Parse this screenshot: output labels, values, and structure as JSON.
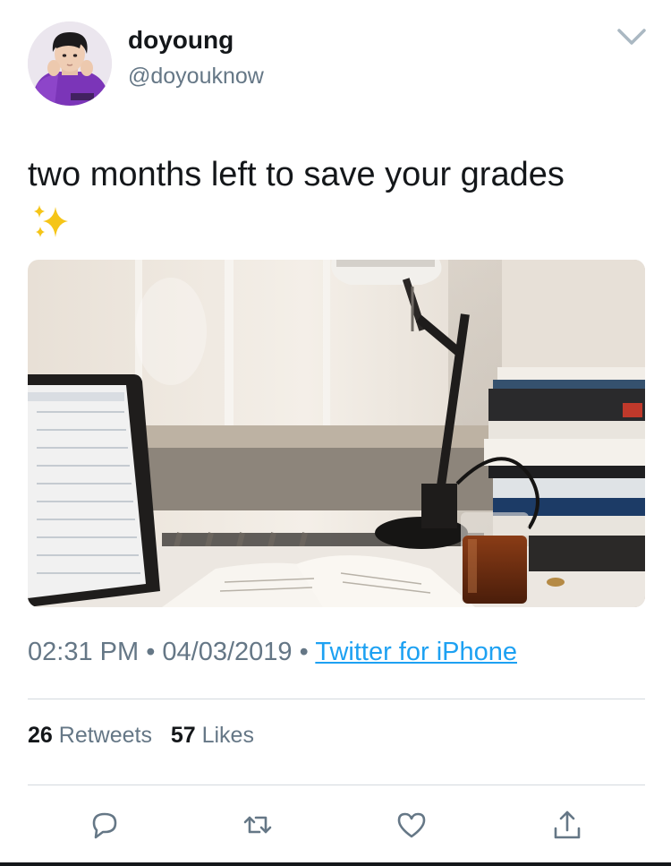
{
  "author": {
    "display_name": "doyoung",
    "handle": "@doyouknow"
  },
  "tweet": {
    "text": "two months left to save your grades",
    "emoji": "sparkles"
  },
  "meta": {
    "time": "02:31 PM",
    "separator": "•",
    "date": "04/03/2019",
    "source": "Twitter for iPhone"
  },
  "stats": {
    "retweets_count": "26",
    "retweets_label": "Retweets",
    "likes_count": "57",
    "likes_label": "Likes"
  },
  "icons": {
    "menu": "chevron-down-icon",
    "reply": "reply-icon",
    "retweet": "retweet-icon",
    "like": "heart-icon",
    "share": "share-icon"
  },
  "colors": {
    "text_primary": "#14171a",
    "text_secondary": "#657786",
    "link": "#1da1f2",
    "divider": "#d4d9de"
  }
}
